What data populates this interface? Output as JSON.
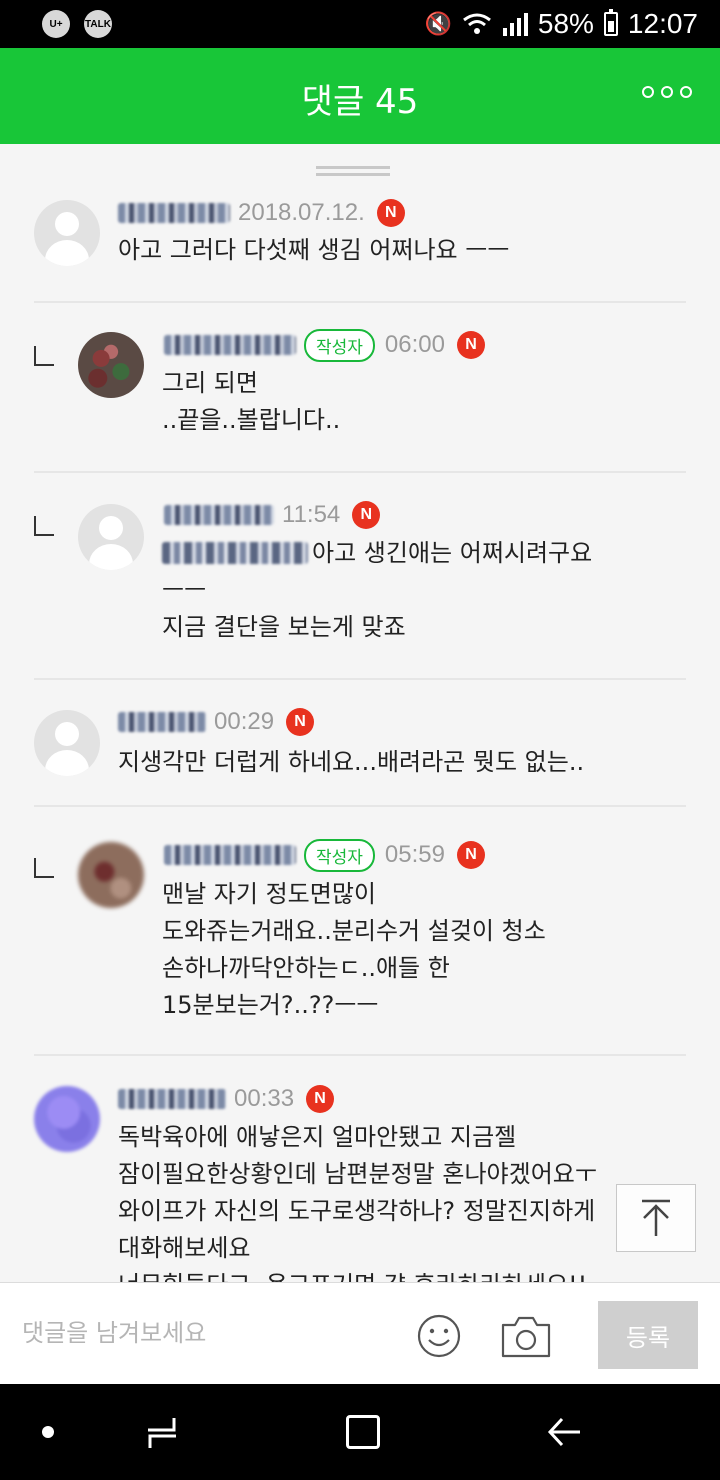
{
  "status_bar": {
    "icons": [
      "lg-uplus-icon",
      "kakaotalk-icon",
      "mute-icon",
      "wifi-icon",
      "signal-icon",
      "battery-icon"
    ],
    "kakao_label": "TALK",
    "battery": "58%",
    "time": "12:07"
  },
  "header": {
    "title": "댓글 45"
  },
  "author_badge": "작성자",
  "new_badge": "N",
  "comments": [
    {
      "date": "2018.07.12.",
      "text": "아고 그러다 다섯째 생김 어쩌나요 ㅡㅡ"
    },
    {
      "date": "06:00",
      "line1": "그리 되면",
      "line2": "..끝을..볼랍니다.."
    },
    {
      "date": "11:54",
      "line1": "아고 생긴애는 어쩌시려구요",
      "line2": "ㅡㅡ",
      "line3": "지금 결단을 보는게 맞죠"
    },
    {
      "date": "00:29",
      "text": "지생각만 더럽게 하네요...배려라곤 뭣도 없는.."
    },
    {
      "date": "05:59",
      "line1": "맨날 자기 정도면많이",
      "line2": "도와쥬는거래요..분리수거 설겆이 청소",
      "line3": "손하나까닥안하는ㄷ..애들 한",
      "line4": "15분보는거?..??ㅡㅡ"
    },
    {
      "date": "00:33",
      "line1": "독박육아에 애낳은지 얼마안됐고 지금젤",
      "line2": "잠이필요한상황인데 남편분정말 혼나야겠어요ㅜ",
      "line3": "와이프가 자신의 도구로생각하나? 정말진지하게",
      "line4": "대화해보세요",
      "line5": "너무힘들다고..욕고프거면 걍 후라하라하세요!!"
    }
  ],
  "input": {
    "placeholder": "댓글을 남겨보세요",
    "value": "",
    "submit_label": "등록"
  },
  "colors": {
    "header_green": "#18c638",
    "author_green": "#18b83a",
    "new_red": "#e8321f"
  }
}
